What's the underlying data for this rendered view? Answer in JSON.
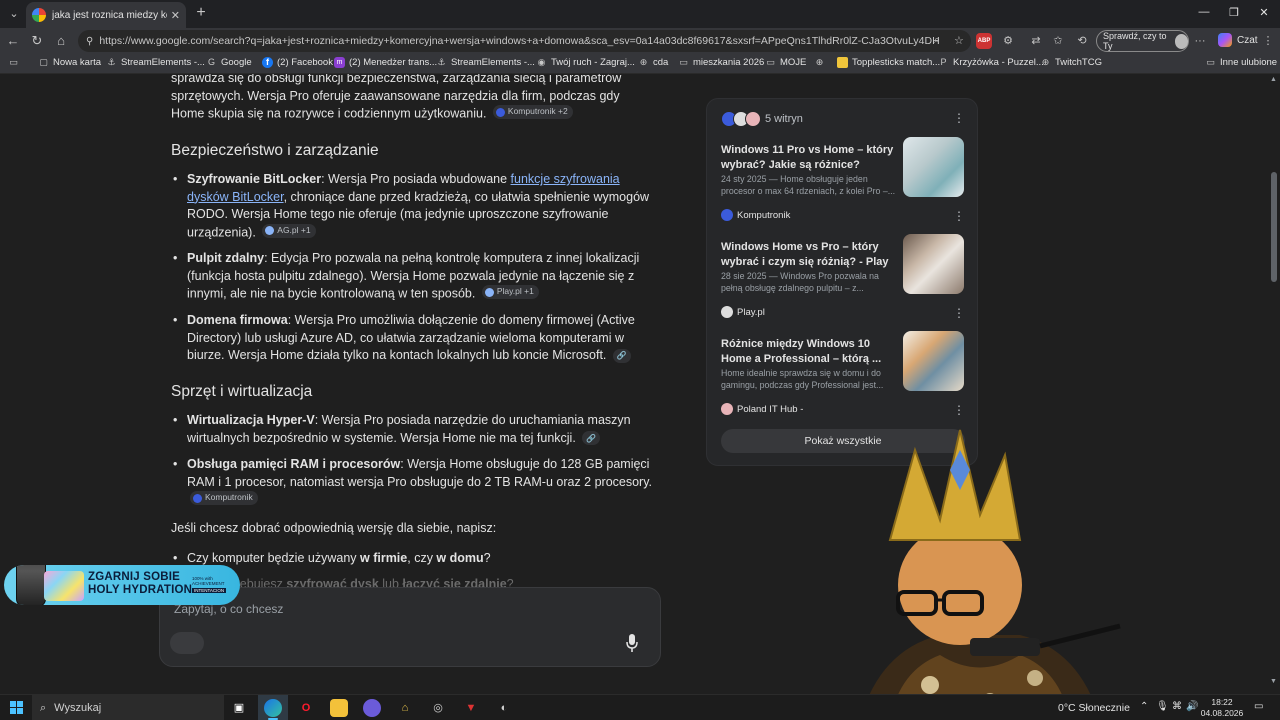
{
  "browser": {
    "tab_title": "jaka jest roznica miedzy komercyjna wersja windows a domowa - Szukaj w Google",
    "url": "https://www.google.com/search?q=jaka+jest+roznica+miedzy+komercyjna+wersja+windows+a+domowa&sca_esv=0a14a03dc8f69617&sxsrf=APpeQns1TlhdRr0lZ-CJa3OtvuLy4DHY6Q%3A17858604...",
    "profile_button": "Sprawdź, czy to Ty",
    "chat_label": "Czat",
    "abp_label": "ABP"
  },
  "bookmarks": [
    {
      "label": "Nowa karta",
      "icon": "new-tab-icon"
    },
    {
      "label": "StreamElements -...",
      "icon": "streamelements-icon"
    },
    {
      "label": "Google",
      "icon": "google-icon"
    },
    {
      "label": "(2) Facebook",
      "icon": "facebook-icon"
    },
    {
      "label": "(2) Menedżer trans...",
      "icon": "messenger-icon"
    },
    {
      "label": "StreamElements -...",
      "icon": "streamelements-icon"
    },
    {
      "label": "Twój ruch - Zagraj...",
      "icon": "game-icon"
    },
    {
      "label": "cda",
      "icon": "globe-icon"
    },
    {
      "label": "mieszkania 2026",
      "icon": "folder-icon"
    },
    {
      "label": "MOJE",
      "icon": "folder-icon"
    },
    {
      "label": "",
      "icon": "globe-icon"
    },
    {
      "label": "Topplesticks match...",
      "icon": "yellow-icon"
    },
    {
      "label": "Krzyżówka - Puzzel...",
      "icon": "puzzel-icon"
    },
    {
      "label": "TwitchTCG",
      "icon": "globe-icon"
    },
    {
      "label": "Inne ulubione",
      "icon": "folder-icon"
    }
  ],
  "article": {
    "intro": "sprawdza się do obsługi funkcji bezpieczeństwa, zarządzania siecią i parametrów sprzętowych. Wersja Pro oferuje zaawansowane narzędzia dla firm, podczas gdy Home skupia się na rozrywce i codziennym użytkowaniu.",
    "intro_chip": "Komputronik +2",
    "section1": "Bezpieczeństwo i zarządzanie",
    "s1_b1_bold": "Szyfrowanie BitLocker",
    "s1_b1_pre": ": Wersja Pro posiada wbudowane ",
    "s1_b1_link": "funkcje szyfrowania dysków BitLocker",
    "s1_b1_post": ", chroniące dane przed kradzieżą, co ułatwia spełnienie wymogów RODO. Wersja Home tego nie oferuje (ma jedynie uproszczone szyfrowanie urządzenia).",
    "s1_b1_chip": "AG.pl +1",
    "s1_b2_bold": "Pulpit zdalny",
    "s1_b2_text": ": Edycja Pro pozwala na pełną kontrolę komputera z innej lokalizacji (funkcja hosta pulpitu zdalnego). Wersja Home pozwala jedynie na łączenie się z innymi, ale nie na bycie kontrolowaną w ten sposób.",
    "s1_b2_chip": "Play.pl +1",
    "s1_b3_bold": "Domena firmowa",
    "s1_b3_text": ": Wersja Pro umożliwia dołączenie do domeny firmowej (Active Directory) lub usługi Azure AD, co ułatwia zarządzanie wieloma komputerami w biurze. Wersja Home działa tylko na kontach lokalnych lub koncie Microsoft.",
    "section2": "Sprzęt i wirtualizacja",
    "s2_b1_bold": "Wirtualizacja Hyper-V",
    "s2_b1_text": ": Wersja Pro posiada narzędzie do uruchamiania maszyn wirtualnych bezpośrednio w systemie. Wersja Home nie ma tej funkcji.",
    "s2_b2_bold": "Obsługa pamięci RAM i procesorów",
    "s2_b2_text": ": Wersja Home obsługuje do 128 GB pamięci RAM i 1 procesor, natomiast wersja Pro obsługuje do 2 TB RAM-u oraz 2 procesory.",
    "s2_b2_chip": "Komputronik",
    "outro": "Jeśli chcesz dobrać odpowiednią wersję dla siebie, napisz:",
    "q1_pre": "Czy komputer będzie używany ",
    "q1_b1": "w firmie",
    "q1_mid": ", czy ",
    "q1_b2": "w domu",
    "q1_post": "?",
    "q2_pre": "Czy potrzebujesz ",
    "q2_b1": "szyfrować dysk",
    "q2_mid": " lub ",
    "q2_b2": "łączyć się zdalnie",
    "q2_post": "?"
  },
  "sources": {
    "count_label": "5 witryn",
    "items": [
      {
        "title": "Windows 11 Pro vs Home – który wybrać? Jakie są różnice?",
        "snippet": "24 sty 2025 — Home obsługuje jeden procesor o max 64 rdzeniach, z kolei Pro –...",
        "site": "Komputronik"
      },
      {
        "title": "Windows Home vs Pro – który wybrać i czym się różnią? - Play",
        "snippet": "28 sie 2025 — Windows Pro pozwala na pełną obsługę zdalnego pulpitu – z...",
        "site": "Play.pl"
      },
      {
        "title": "Różnice między Windows 10 Home a Professional – którą ...",
        "snippet": "Home idealnie sprawdza się w domu i do gamingu, podczas gdy Professional jest...",
        "site": "Poland IT Hub -"
      }
    ],
    "show_all": "Pokaż wszystkie"
  },
  "ask": {
    "placeholder": "Zapytaj, o co chcesz"
  },
  "promo": {
    "line1": "ZGARNIJ SOBIE",
    "line2": "HOLY HYDRATION",
    "brand": "100% with ACHIEVEMENT",
    "brand_tag": "INTENTACION"
  },
  "taskbar": {
    "search": "Wyszukaj",
    "weather": "0°C  Słonecznie",
    "time": "18:22",
    "date": "04.08.2026"
  }
}
